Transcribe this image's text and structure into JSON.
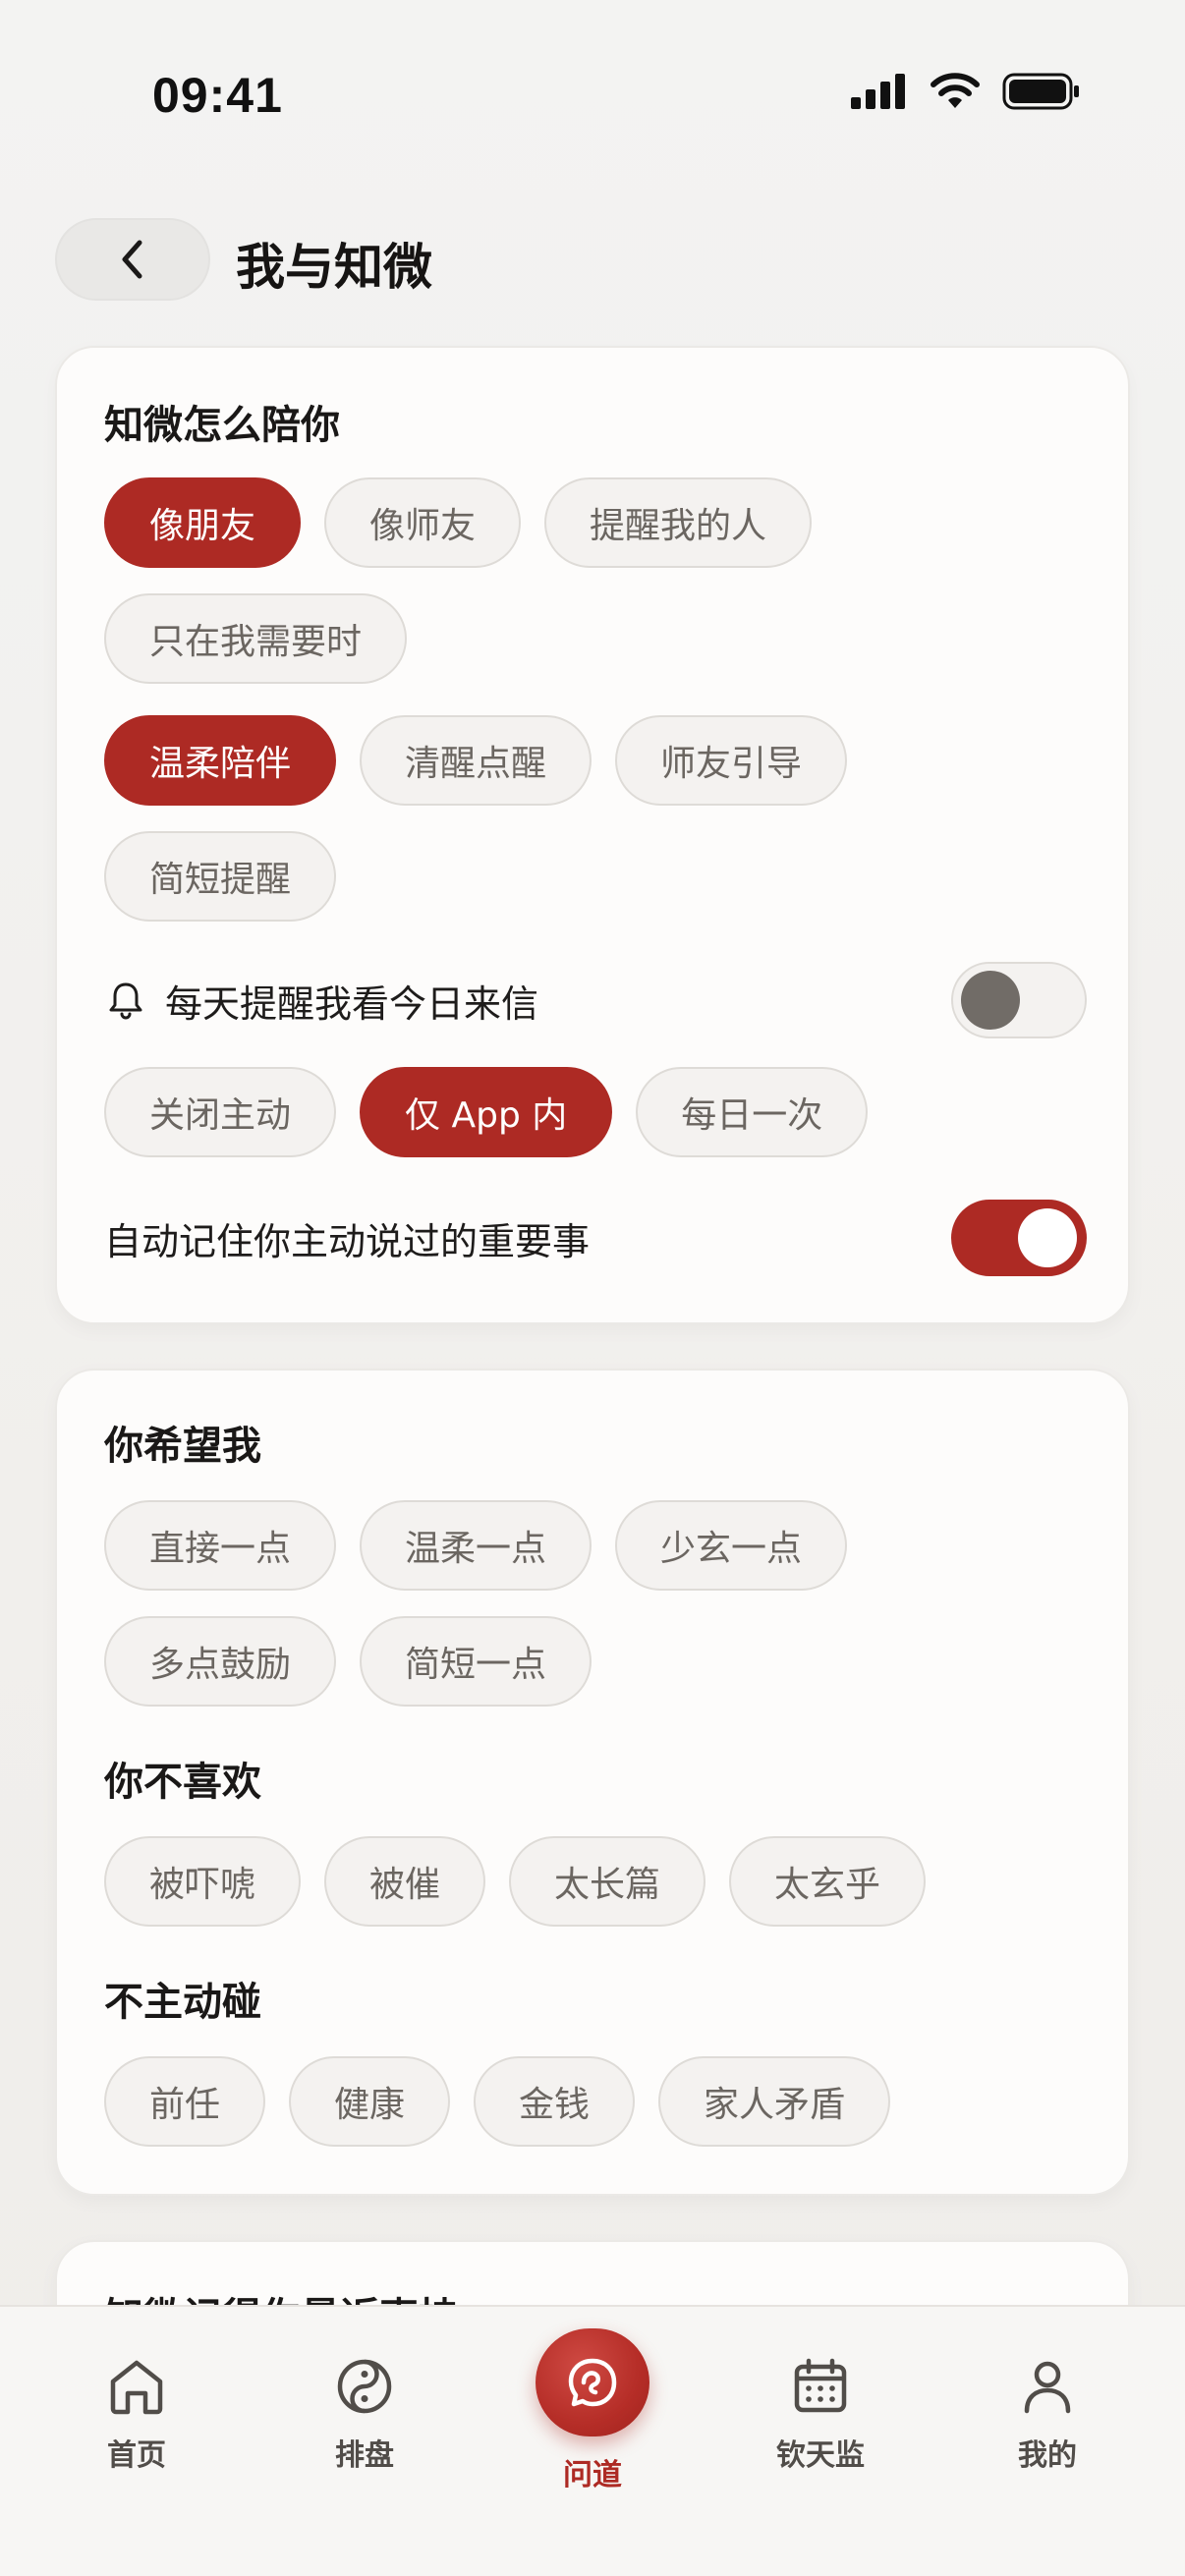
{
  "status_bar": {
    "time": "09:41"
  },
  "header": {
    "title": "我与知微"
  },
  "card1": {
    "title": "知微怎么陪你",
    "companion_chips": [
      {
        "label": "像朋友",
        "active": true
      },
      {
        "label": "像师友",
        "active": false
      },
      {
        "label": "提醒我的人",
        "active": false
      },
      {
        "label": "只在我需要时",
        "active": false
      }
    ],
    "tone_chips": [
      {
        "label": "温柔陪伴",
        "active": true
      },
      {
        "label": "清醒点醒",
        "active": false
      },
      {
        "label": "师友引导",
        "active": false
      },
      {
        "label": "简短提醒",
        "active": false
      }
    ],
    "daily_reminder": {
      "label": "每天提醒我看今日来信",
      "on": false
    },
    "reminder_chips": [
      {
        "label": "关闭主动",
        "active": false
      },
      {
        "label": "仅 App 内",
        "active": true
      },
      {
        "label": "每日一次",
        "active": false
      }
    ],
    "auto_remember": {
      "label": "自动记住你主动说过的重要事",
      "on": true
    }
  },
  "card2": {
    "wish_title": "你希望我",
    "wish_chips": [
      "直接一点",
      "温柔一点",
      "少玄一点",
      "多点鼓励",
      "简短一点"
    ],
    "dislike_title": "你不喜欢",
    "dislike_chips": [
      "被吓唬",
      "被催",
      "太长篇",
      "太玄乎"
    ],
    "avoid_title": "不主动碰",
    "avoid_chips": [
      "前任",
      "健康",
      "金钱",
      "家人矛盾"
    ]
  },
  "card3": {
    "title": "知微记得你最近声持"
  },
  "bottom_nav": {
    "items": [
      {
        "label": "首页",
        "icon": "home-icon"
      },
      {
        "label": "排盘",
        "icon": "yin-yang-icon"
      },
      {
        "label": "问道",
        "icon": "chat-swirl-icon",
        "active": true
      },
      {
        "label": "钦天监",
        "icon": "calendar-icon"
      },
      {
        "label": "我的",
        "icon": "user-icon"
      }
    ]
  },
  "colors": {
    "accent": "#ad2a24",
    "chip_bg": "#f4f2f0",
    "card_bg": "#fdfcfb"
  }
}
